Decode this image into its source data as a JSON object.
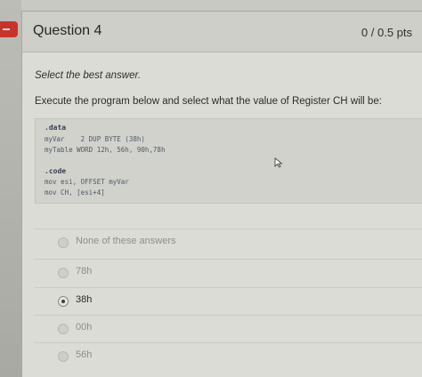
{
  "question": {
    "title": "Question 4",
    "points": "0 / 0.5 pts",
    "instruction": "Select the best answer.",
    "prompt": "Execute the program below and select what the value of Register CH will be:"
  },
  "code": {
    "lines": [
      ".data",
      "myVar    2 DUP BYTE (38h)",
      "myTable WORD 12h, 56h, 90h,78h",
      ".code",
      "mov esi, OFFSET myVar",
      "mov CH, [esi+4]"
    ]
  },
  "answers": [
    {
      "label": "None of these answers",
      "selected": false
    },
    {
      "label": "78h",
      "selected": false
    },
    {
      "label": "38h",
      "selected": true
    },
    {
      "label": "00h",
      "selected": false
    },
    {
      "label": "56h",
      "selected": false
    }
  ],
  "colors": {
    "accent_tab": "#c6342b"
  },
  "icons": {
    "cursor": "mouse-pointer-icon",
    "tab": "menu-icon"
  }
}
